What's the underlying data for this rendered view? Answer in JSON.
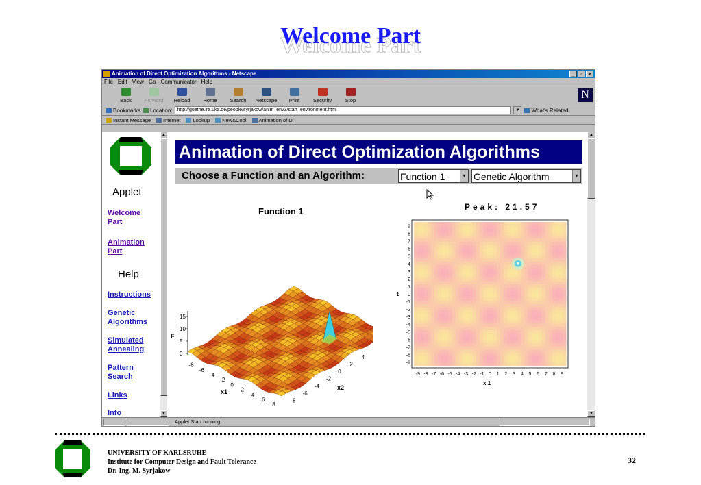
{
  "slide": {
    "title": "Welcome Part",
    "page_number": "32"
  },
  "footer": {
    "line1": "UNIVERSITY OF KARLSRUHE",
    "line2": "Institute for Computer Design and Fault Tolerance",
    "line3": "Dr.-Ing. M. Syrjakow"
  },
  "browser": {
    "window_title": "Animation of Direct Optimization Algorithms - Netscape",
    "controls": [
      "_",
      "▫",
      "×"
    ],
    "menu": [
      "File",
      "Edit",
      "View",
      "Go",
      "Communicator",
      "Help"
    ],
    "toolbar": [
      {
        "label": "Back",
        "icon": "back-arrow-icon",
        "color": "#2e8b2e"
      },
      {
        "label": "Forward",
        "icon": "forward-arrow-icon",
        "color": "#9fc79f"
      },
      {
        "label": "Reload",
        "icon": "reload-icon",
        "color": "#3050a0"
      },
      {
        "label": "Home",
        "icon": "home-icon",
        "color": "#607090"
      },
      {
        "label": "Search",
        "icon": "search-icon",
        "color": "#b08030"
      },
      {
        "label": "Netscape",
        "icon": "netscape-icon",
        "color": "#305080"
      },
      {
        "label": "Print",
        "icon": "print-icon",
        "color": "#4070a0"
      },
      {
        "label": "Security",
        "icon": "security-lock-icon",
        "color": "#c03020"
      },
      {
        "label": "Stop",
        "icon": "stop-icon",
        "color": "#a02020"
      }
    ],
    "bookmarks_label": "Bookmarks",
    "location_label": "Location:",
    "url": "http://goethe.ira.uka.de/people/syrjakow/anim_env3/start_environment.html",
    "whats_related": "What's Related",
    "personal_toolbar": [
      "Instant Message",
      "Internet",
      "Lookup",
      "New&Cool",
      "Animation of Di"
    ],
    "status_text": "Applet Start running"
  },
  "sidebar": {
    "applet_label": "Applet",
    "help_label": "Help",
    "links": [
      {
        "id": "welcome",
        "lines": [
          "Welcome",
          "Part"
        ]
      },
      {
        "id": "animation",
        "lines": [
          "Animation",
          "Part"
        ]
      },
      {
        "id": "instructions",
        "lines": [
          "Instructions"
        ]
      },
      {
        "id": "genetic",
        "lines": [
          "Genetic",
          "Algorithms"
        ]
      },
      {
        "id": "simulated",
        "lines": [
          "Simulated",
          "Annealing"
        ]
      },
      {
        "id": "pattern",
        "lines": [
          "Pattern",
          "Search"
        ]
      },
      {
        "id": "links",
        "lines": [
          "Links"
        ]
      },
      {
        "id": "info",
        "lines": [
          "Info"
        ]
      }
    ]
  },
  "applet": {
    "title": "Animation of Direct Optimization Algorithms",
    "choose_label": "Choose a Function and an Algorithm:",
    "function_select": "Function 1",
    "algorithm_select": "Genetic Algorithm",
    "plot3d_title": "Function 1",
    "peak_label": "Peak: 21.57",
    "plot3d_axes": {
      "z_label": "F",
      "z_ticks": [
        "15",
        "10",
        "5",
        "0"
      ],
      "x_label": "x1",
      "y_label": "x2",
      "x_ticks": [
        "-8",
        "-6",
        "-4",
        "-2",
        "0",
        "2",
        "4",
        "6",
        "8"
      ],
      "y_ticks": [
        "-8",
        "-6",
        "-4",
        "-2",
        "0",
        "2",
        "4",
        "6",
        "8"
      ]
    },
    "contour_axes": {
      "x_label": "x 1",
      "y_label": "x 2",
      "x_ticks": [
        "-9",
        "-8",
        "-7",
        "-6",
        "-5",
        "-4",
        "-3",
        "-2",
        "-1",
        "0",
        "1",
        "2",
        "3",
        "4",
        "5",
        "6",
        "7",
        "8",
        "9"
      ],
      "y_ticks": [
        "9",
        "8",
        "7",
        "6",
        "5",
        "4",
        "3",
        "2",
        "1",
        "0",
        "-1",
        "-2",
        "-3",
        "-4",
        "-5",
        "-6",
        "-7",
        "-8",
        "-9"
      ],
      "peak_x": 3.5,
      "peak_y": 4
    }
  }
}
